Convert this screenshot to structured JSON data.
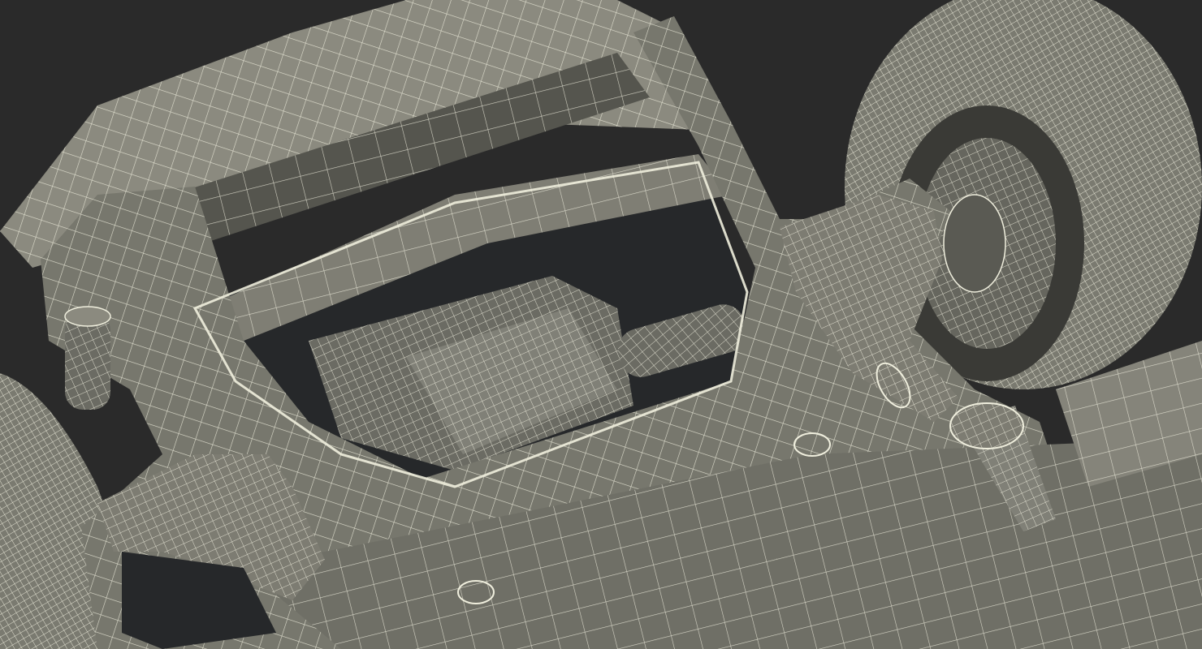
{
  "colors": {
    "background": "#2a2a2a",
    "surface": "#77776d",
    "surface_light": "#8b8a7f",
    "surface_dark": "#55554e",
    "shadow": "#2f2f2c",
    "wire": "#efeedd",
    "cavity": "#26282a"
  }
}
